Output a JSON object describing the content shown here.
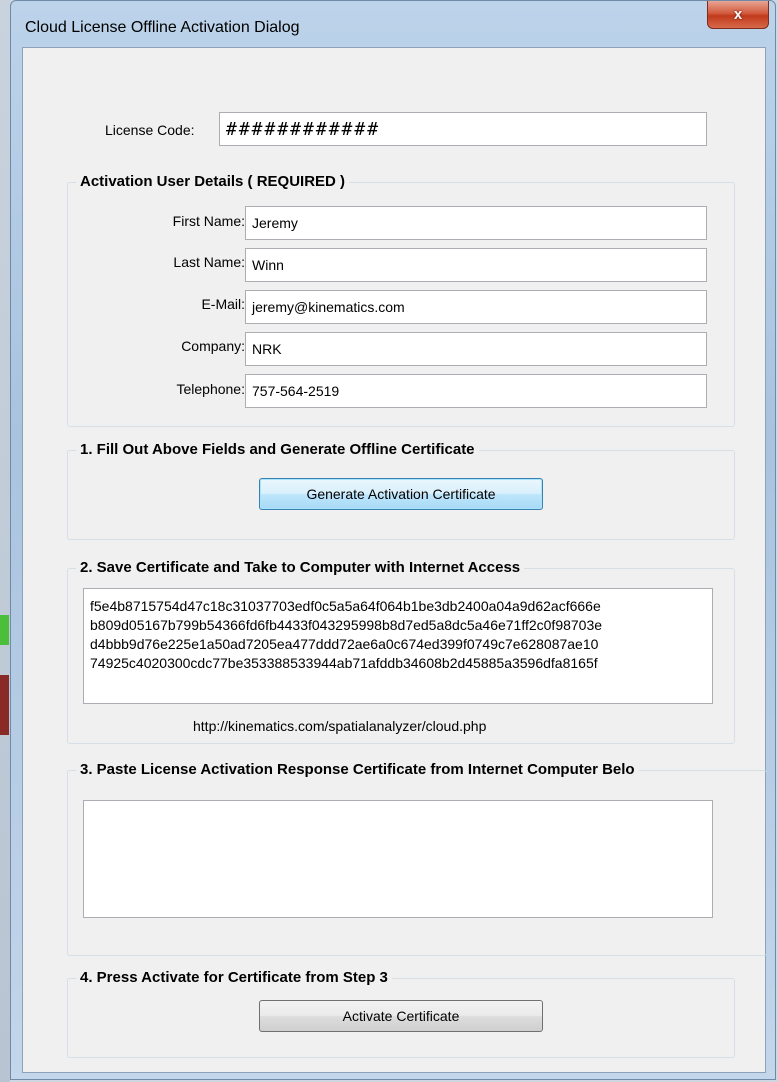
{
  "window": {
    "title": "Cloud License Offline Activation Dialog",
    "close_glyph": "x"
  },
  "license": {
    "label": "License Code:",
    "value": "############"
  },
  "user_details": {
    "title": "Activation User Details ( REQUIRED )",
    "fields": [
      {
        "label": "First Name:",
        "value": "Jeremy"
      },
      {
        "label": "Last Name:",
        "value": "Winn"
      },
      {
        "label": "E-Mail:",
        "value": "jeremy@kinematics.com"
      },
      {
        "label": "Company:",
        "value": "NRK"
      },
      {
        "label": "Telephone:",
        "value": "757-564-2519"
      }
    ]
  },
  "step1": {
    "title": "1. Fill Out Above Fields and Generate Offline Certificate",
    "button": "Generate Activation Certificate"
  },
  "step2": {
    "title": "2. Save Certificate and Take to Computer with Internet Access",
    "certificate_lines": [
      "f5e4b8715754d47c18c31037703edf0c5a5a64f064b1be3db2400a04a9d62acf666e",
      "b809d05167b799b54366fd6fb4433f043295998b8d7ed5a8dc5a46e71ff2c0f98703e",
      "d4bbb9d76e225e1a50ad7205ea477ddd72ae6a0c674ed399f0749c7e628087ae10",
      "74925c4020300cdc77be353388533944ab71afddb34608b2d45885a3596dfa8165f"
    ],
    "url": "http://kinematics.com/spatialanalyzer/cloud.php"
  },
  "step3": {
    "title": "3. Paste License Activation Response Certificate from Internet Computer Belo",
    "response_value": ""
  },
  "step4": {
    "title": "4. Press Activate for Certificate from Step 3",
    "button": "Activate Certificate"
  },
  "colors": {
    "titlebar": "#a9c3df",
    "close_button": "#c13a1c",
    "client_background": "#f0f0f0",
    "focused_button": "#bee6fd"
  }
}
